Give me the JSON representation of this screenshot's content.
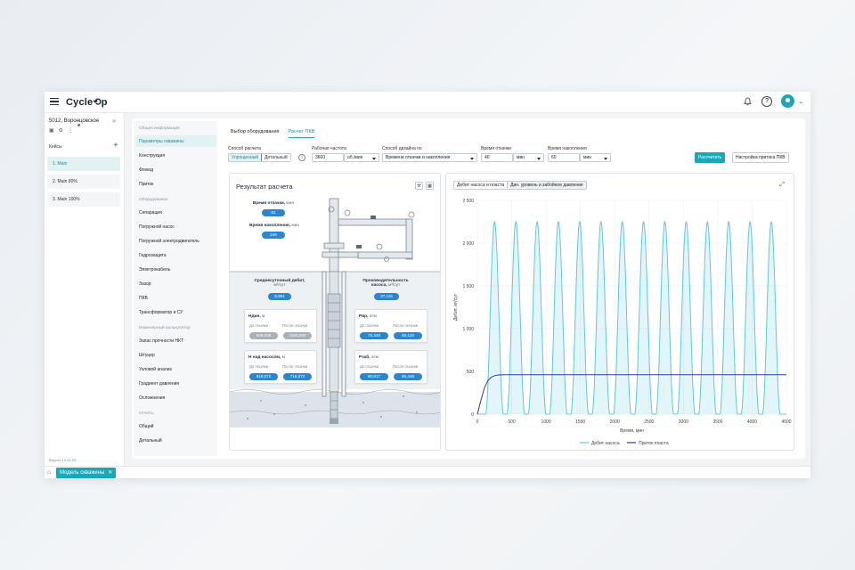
{
  "app": {
    "logo": "Cycle⟲p"
  },
  "well": {
    "title": "5012, Воронцовское"
  },
  "cases": {
    "header": "Кейсы",
    "items": [
      "1. Main",
      "2. Main 80%",
      "3. Main 100%"
    ]
  },
  "version": "Версия 10.04.25",
  "bottom_tab": {
    "label": "Модель скважины",
    "close": "✕"
  },
  "nav": {
    "groups": [
      {
        "title": "Общая информация",
        "items": [
          "Параметры скважины",
          "Конструкция",
          "Флюид",
          "Приток"
        ]
      },
      {
        "title": "Оборудование",
        "items": [
          "Сепарация",
          "Погружной насос",
          "Погружной электродвигатель",
          "Гидрозащита",
          "Электрокабель",
          "Зазор",
          "ПКВ",
          "Трансформатор и СУ"
        ]
      },
      {
        "title": "Инженерный калькулятор",
        "items": [
          "Запас прочности НКТ",
          "Штуцер",
          "Узловой анализ",
          "Градиент давления",
          "Осложнения"
        ]
      },
      {
        "title": "Отчеты",
        "items": [
          "Общий",
          "Детальный"
        ]
      }
    ]
  },
  "tabs": [
    "Выбор оборудования",
    "Расчет ПКВ"
  ],
  "params": {
    "calc_method_label": "Способ расчета",
    "calc_method_options": [
      "Упрощенный",
      "Детальный"
    ],
    "freq_label": "Рабочая частота",
    "freq_value": "3600",
    "freq_unit": "об./мин",
    "design_label": "Способ дизайна по",
    "design_value": "Времени откачки и накопления",
    "pump_time_label": "Время откачки",
    "pump_time_value": "40",
    "pump_time_unit": "мин",
    "accum_time_label": "Время накопления",
    "accum_time_value": "60",
    "accum_time_unit": "мин",
    "calc_button": "Рассчитать",
    "settings_button": "Настройка притока ПКВ"
  },
  "result": {
    "title": "Результат расчета",
    "pump_time": {
      "label": "Время откачки,",
      "unit": "мин",
      "value": "61"
    },
    "accum_time": {
      "label": "Время накопления,",
      "unit": "мин",
      "value": "249"
    },
    "daily_rate": {
      "label": "Среднесуточный дебит,",
      "unit": "м³/сут",
      "value": "6,991"
    },
    "pump_perf": {
      "label": "Производительность насоса,",
      "unit": "м³/сут",
      "value": "37,115"
    },
    "before_label": "До откачки",
    "after_label": "После откачки",
    "hdyn": {
      "title": "Ндин,",
      "unit": "м",
      "before": "509,035",
      "after": "1665,000"
    },
    "hpump": {
      "title": "Н над насосом,",
      "unit": "м",
      "before": "919,072",
      "after": "719,072"
    },
    "pbuf": {
      "title": "Рвр,",
      "unit": "атм",
      "before": "75,345",
      "after": "60,118"
    },
    "pzab": {
      "title": "Рзаб,",
      "unit": "атм",
      "before": "80,617",
      "after": "65,446"
    }
  },
  "chart_toggle": [
    "Дебит насоса и пласта",
    "Дин. уровень и забойное давление"
  ],
  "colors": {
    "accent": "#1aa7b8",
    "pill": "#2b86d1",
    "series_pump": "#5fc8e0",
    "series_inflow": "#2a3f8f"
  },
  "chart_data": {
    "type": "line",
    "title": "",
    "xlabel": "Время, мин",
    "ylabel": "Дебит, м³/сут",
    "xlim": [
      0,
      4500
    ],
    "ylim": [
      0,
      2500
    ],
    "x_ticks": [
      0,
      500,
      1000,
      1500,
      2000,
      2500,
      3000,
      3500,
      4000,
      4500
    ],
    "y_ticks": [
      0,
      500,
      1000,
      1500,
      2000,
      2500
    ],
    "x_tick_labels": [
      "0",
      "500",
      "1000",
      "1500",
      "2000",
      "2500",
      "3000",
      "3500",
      "4000",
      "4500"
    ],
    "y_tick_labels": [
      "0",
      "500",
      "1 000",
      "1 500",
      "2 000",
      "2 500"
    ],
    "grid": true,
    "legend_position": "bottom",
    "series": [
      {
        "name": "Дебит насоса",
        "kind": "area",
        "color": "#5fc8e0",
        "pulse_peaks_x": [
          250,
          560,
          870,
          1180,
          1490,
          1800,
          2110,
          2420,
          2730,
          3040,
          3350,
          3660,
          3970,
          4280
        ],
        "pulse_peak_value": 2250,
        "pulse_half_width": 130
      },
      {
        "name": "Приток пласта",
        "kind": "line",
        "color": "#2a3f8f",
        "x": [
          0,
          50,
          100,
          150,
          200,
          250,
          300,
          400,
          500,
          4500
        ],
        "y": [
          0,
          160,
          300,
          390,
          430,
          450,
          458,
          460,
          460,
          460
        ]
      }
    ]
  }
}
